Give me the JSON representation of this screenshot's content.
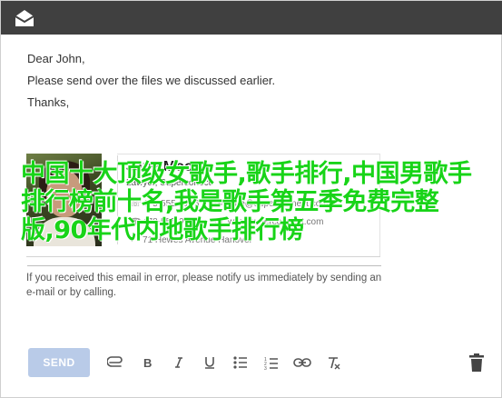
{
  "email": {
    "body_lines": [
      "Dear John,",
      "Please send over the files we discussed earlier.",
      "Thanks,"
    ]
  },
  "signature": {
    "name": "Jane Moore",
    "title": "Lawyer, Superconect",
    "phone": "475-555-0146",
    "email": "jane@superconnect.com",
    "fax": "478-555-0147",
    "website": "www.superconnect.com",
    "address": "71 Hewes Avenue Hanover"
  },
  "overlay_text": "中国十大顶级女歌手,歌手排行,中国男歌手排行榜前十名,我是歌手第五季免费完整版,90年代内地歌手排行榜",
  "disclaimer": "If you received this email in error, please notify us immediately by sending an e-mail or by calling.",
  "toolbar": {
    "send_label": "SEND"
  },
  "icons": {
    "title": "mail-open-icon",
    "attach": "paperclip-icon",
    "bold": "bold-icon",
    "italic": "italic-icon",
    "underline": "underline-icon",
    "bullets": "bulleted-list-icon",
    "numbered": "numbered-list-icon",
    "link": "link-icon",
    "clear": "clear-format-icon",
    "delete": "trash-icon"
  },
  "colors": {
    "titlebar": "#404040",
    "send_button": "#b9cbe8",
    "overlay_text": "#18d418"
  }
}
